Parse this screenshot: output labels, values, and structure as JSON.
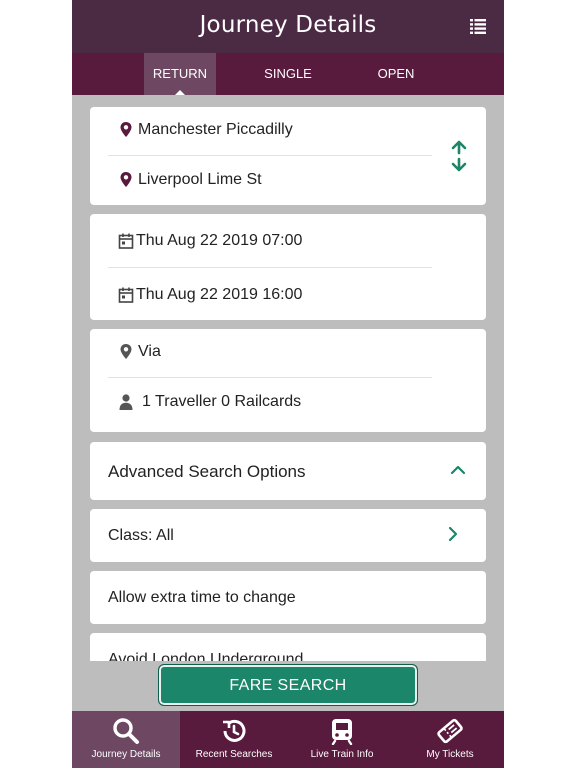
{
  "header": {
    "title": "Journey Details"
  },
  "tabs": [
    {
      "label": "RETURN"
    },
    {
      "label": "SINGLE"
    },
    {
      "label": "OPEN"
    }
  ],
  "stations": {
    "from": "Manchester Piccadilly",
    "to": "Liverpool Lime St"
  },
  "dates": {
    "outbound": "Thu Aug 22 2019 07:00",
    "return": "Thu Aug 22 2019 16:00"
  },
  "extras": {
    "via": "Via",
    "travellers": "1 Traveller 0 Railcards"
  },
  "advanced": {
    "title": "Advanced Search Options",
    "class_label": "Class: All",
    "extra_time": "Allow extra time to change",
    "avoid_underground": "Avoid London Underground"
  },
  "actions": {
    "fare_search": "FARE SEARCH"
  },
  "bottom_nav": [
    {
      "label": "Journey Details",
      "icon": "search-icon"
    },
    {
      "label": "Recent Searches",
      "icon": "history-icon"
    },
    {
      "label": "Live Train Info",
      "icon": "train-icon"
    },
    {
      "label": "My Tickets",
      "icon": "ticket-icon"
    }
  ],
  "colors": {
    "header": "#4b2b44",
    "tabbar": "#581a3d",
    "accent_green": "#1b8669",
    "background": "#bdbdbd"
  }
}
